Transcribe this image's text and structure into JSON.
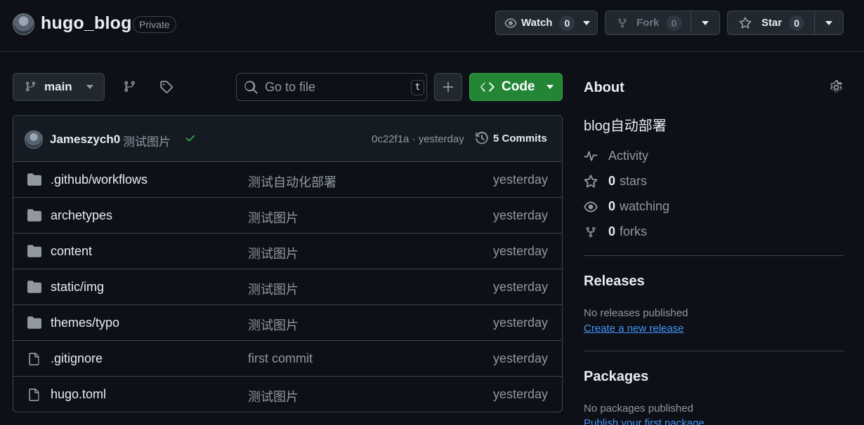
{
  "repo": {
    "name": "hugo_blog",
    "visibility": "Private"
  },
  "actions": {
    "watch_label": "Watch",
    "watch_count": "0",
    "fork_label": "Fork",
    "fork_count": "0",
    "star_label": "Star",
    "star_count": "0"
  },
  "toolbar": {
    "branch": "main",
    "search_placeholder": "Go to file",
    "search_shortcut": "t",
    "code_label": "Code"
  },
  "latest_commit": {
    "author": "Jameszych0",
    "message": "测试图片",
    "hash_time": "0c22f1a · yesterday",
    "commits_label": "5 Commits"
  },
  "files": [
    {
      "type": "folder",
      "name": ".github/workflows",
      "message": "测试自动化部署",
      "date": "yesterday"
    },
    {
      "type": "folder",
      "name": "archetypes",
      "message": "测试图片",
      "date": "yesterday"
    },
    {
      "type": "folder",
      "name": "content",
      "message": "测试图片",
      "date": "yesterday"
    },
    {
      "type": "folder",
      "name": "static/img",
      "message": "测试图片",
      "date": "yesterday"
    },
    {
      "type": "folder",
      "name": "themes/typo",
      "message": "测试图片",
      "date": "yesterday"
    },
    {
      "type": "file",
      "name": ".gitignore",
      "message": "first commit",
      "date": "yesterday"
    },
    {
      "type": "file",
      "name": "hugo.toml",
      "message": "测试图片",
      "date": "yesterday"
    }
  ],
  "about": {
    "title": "About",
    "description": "blog自动部署",
    "activity": "Activity",
    "stars_count": "0",
    "stars_label": "stars",
    "watching_count": "0",
    "watching_label": "watching",
    "forks_count": "0",
    "forks_label": "forks"
  },
  "releases": {
    "title": "Releases",
    "empty": "No releases published",
    "create_link": "Create a new release"
  },
  "packages": {
    "title": "Packages",
    "empty": "No packages published",
    "publish_link": "Publish your first package"
  },
  "colors": {
    "background": "#0d1117",
    "border": "#3d444d",
    "accent_green": "#238636",
    "link_blue": "#4493f8",
    "check_green": "#3fb950"
  }
}
